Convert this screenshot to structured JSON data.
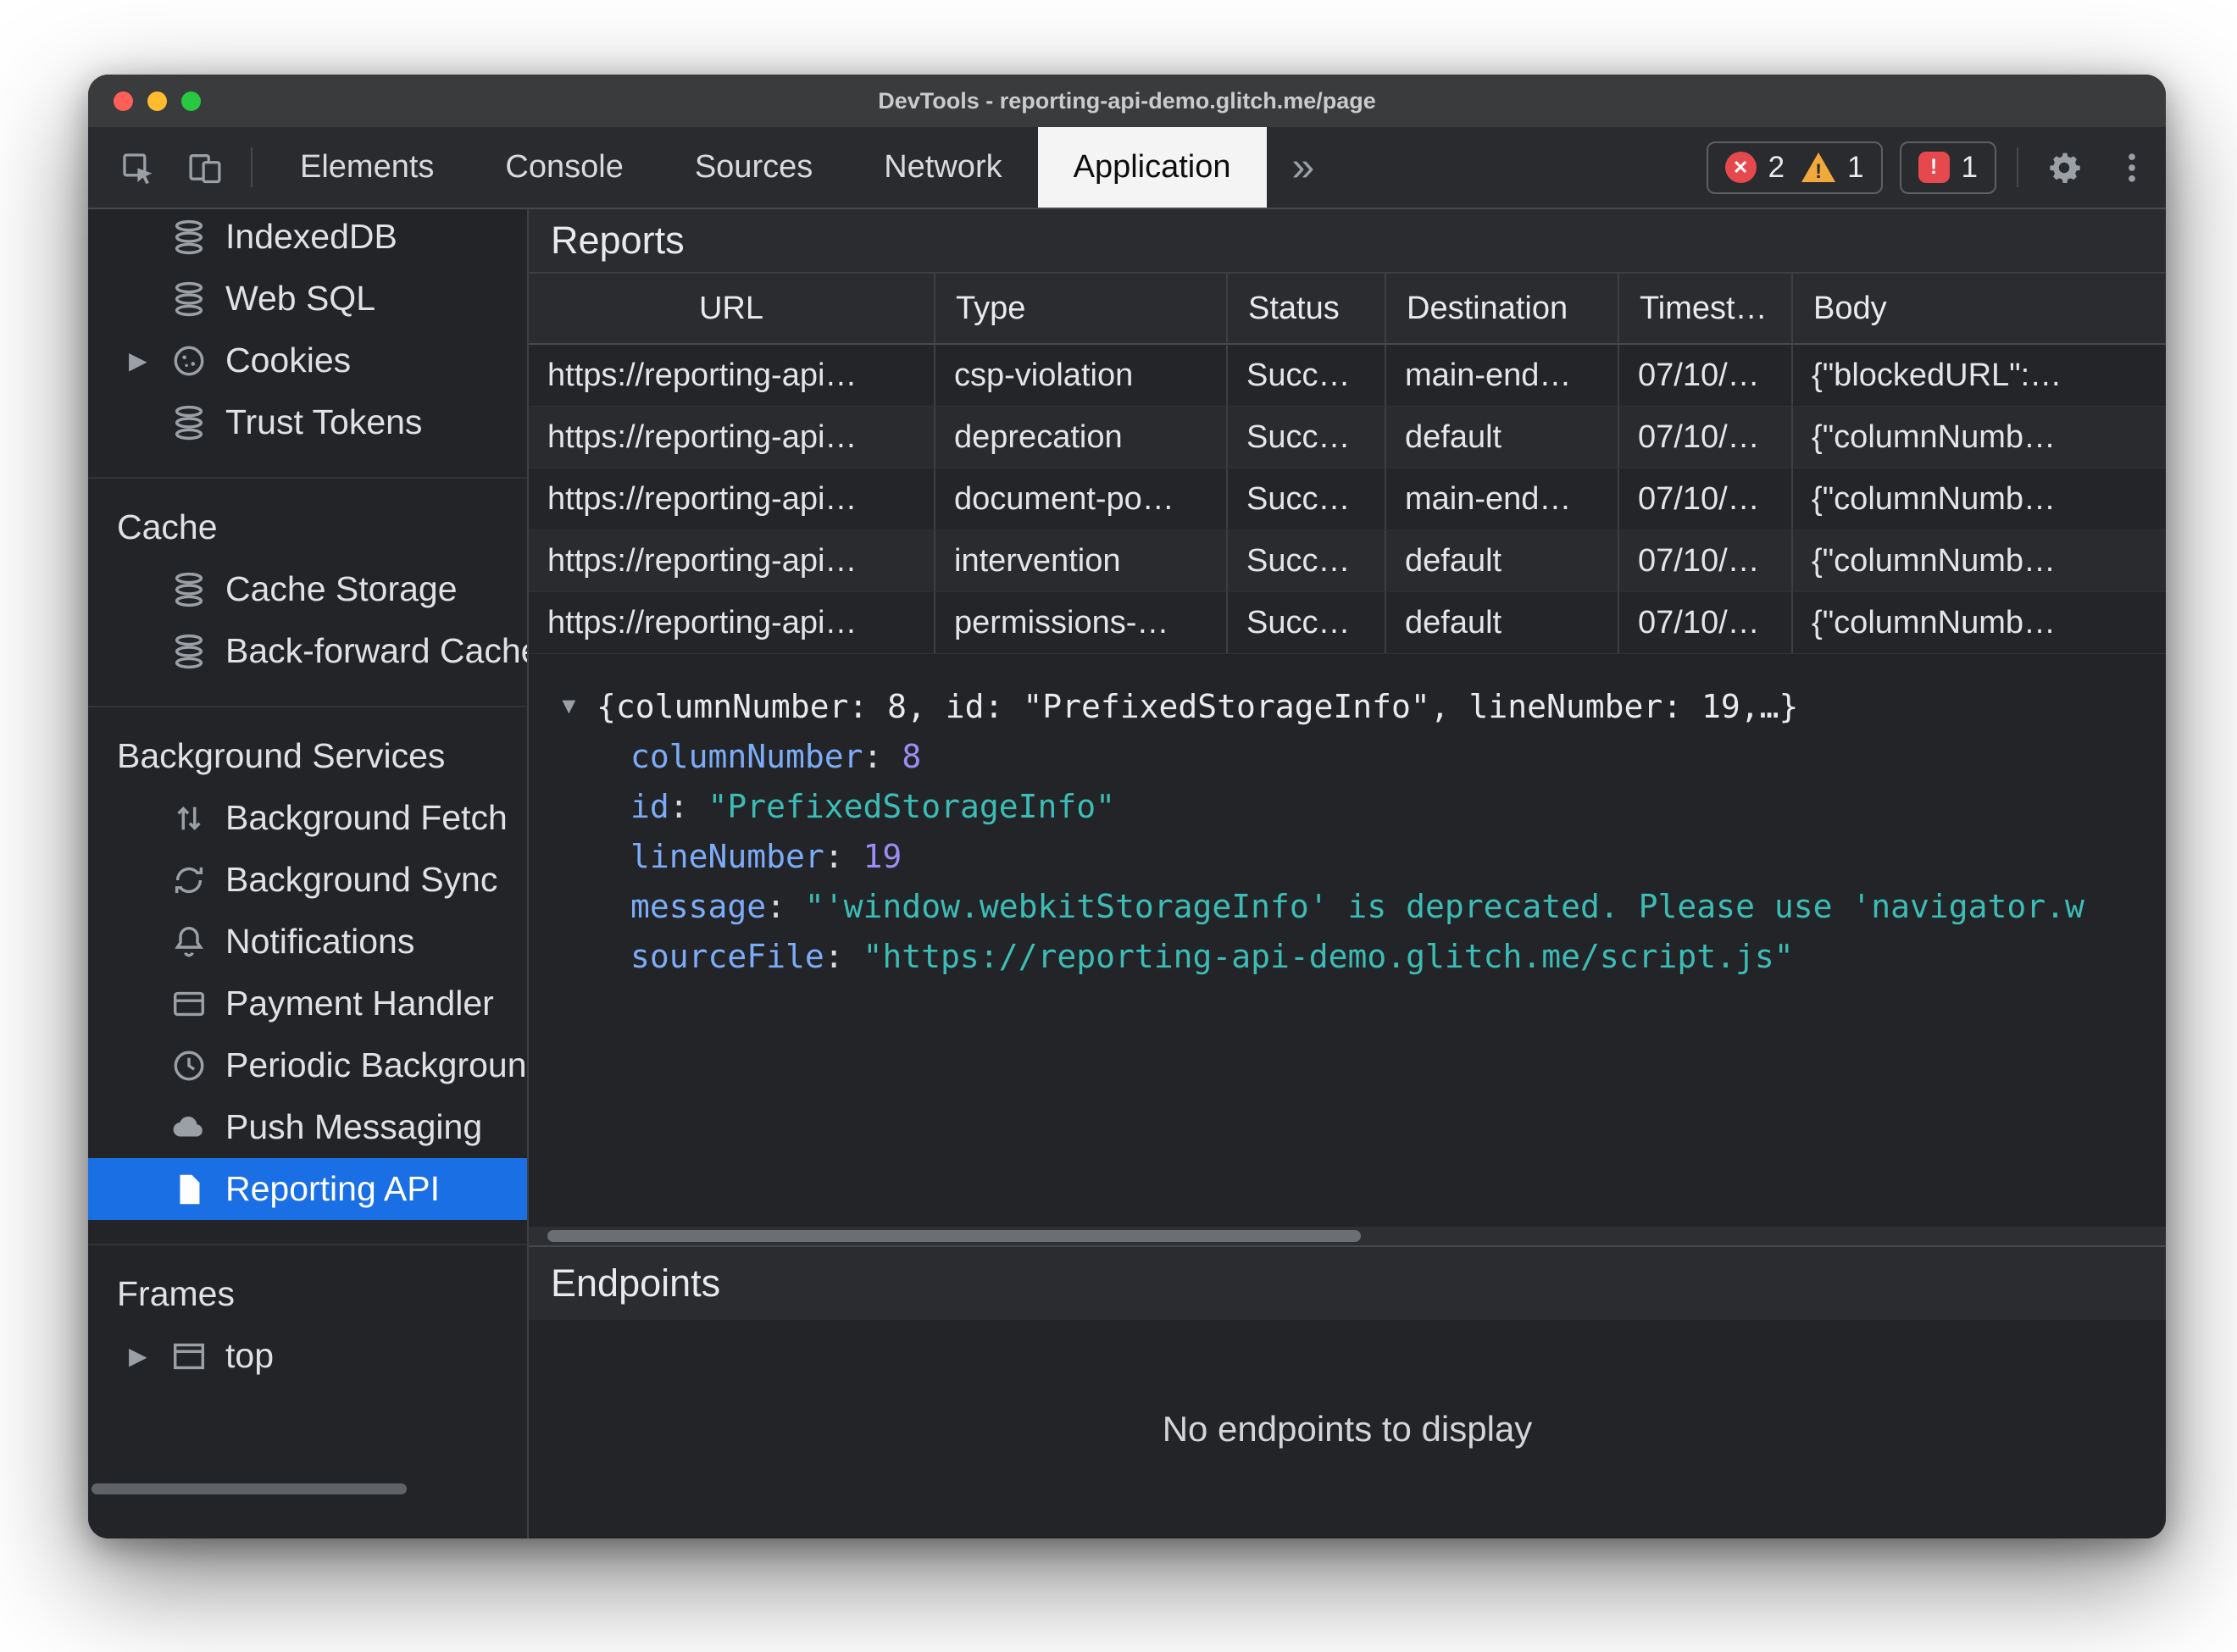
{
  "window": {
    "title": "DevTools - reporting-api-demo.glitch.me/page"
  },
  "colors": {
    "accent": "#1a73e8",
    "error": "#e5484d",
    "warning": "#f2a93c",
    "selected_tab": "#f4f4f5"
  },
  "toolbar": {
    "tabs": [
      {
        "label": "Elements"
      },
      {
        "label": "Console"
      },
      {
        "label": "Sources"
      },
      {
        "label": "Network"
      },
      {
        "label": "Application"
      }
    ],
    "more_tabs_icon": "chevron-double-right",
    "errors": "2",
    "warnings": "1",
    "issues": "1"
  },
  "sidebar": {
    "groups": [
      {
        "items": [
          {
            "label": "IndexedDB",
            "icon": "database-icon"
          },
          {
            "label": "Web SQL",
            "icon": "database-icon"
          },
          {
            "label": "Cookies",
            "icon": "cookie-icon"
          },
          {
            "label": "Trust Tokens",
            "icon": "database-icon"
          }
        ]
      },
      {
        "title": "Cache",
        "items": [
          {
            "label": "Cache Storage",
            "icon": "database-icon"
          },
          {
            "label": "Back-forward Cache",
            "icon": "database-icon"
          }
        ]
      },
      {
        "title": "Background Services",
        "items": [
          {
            "label": "Background Fetch",
            "icon": "fetch-arrows-icon"
          },
          {
            "label": "Background Sync",
            "icon": "sync-icon"
          },
          {
            "label": "Notifications",
            "icon": "bell-icon"
          },
          {
            "label": "Payment Handler",
            "icon": "payment-card-icon"
          },
          {
            "label": "Periodic Background Sync",
            "icon": "clock-icon"
          },
          {
            "label": "Push Messaging",
            "icon": "cloud-icon"
          },
          {
            "label": "Reporting API",
            "icon": "document-icon"
          }
        ]
      },
      {
        "title": "Frames",
        "items": [
          {
            "label": "top",
            "icon": "frame-icon"
          }
        ]
      }
    ]
  },
  "reports": {
    "title": "Reports",
    "columns": [
      "URL",
      "Type",
      "Status",
      "Destination",
      "Timest…",
      "Body"
    ],
    "rows": [
      {
        "url": "https://reporting-api…",
        "type": "csp-violation",
        "status": "Succ…",
        "destination": "main-end…",
        "timestamp": "07/10/…",
        "body": "{\"blockedURL\":…"
      },
      {
        "url": "https://reporting-api…",
        "type": "deprecation",
        "status": "Succ…",
        "destination": "default",
        "timestamp": "07/10/…",
        "body": "{\"columnNumb…"
      },
      {
        "url": "https://reporting-api…",
        "type": "document-po…",
        "status": "Succ…",
        "destination": "main-end…",
        "timestamp": "07/10/…",
        "body": "{\"columnNumb…"
      },
      {
        "url": "https://reporting-api…",
        "type": "intervention",
        "status": "Succ…",
        "destination": "default",
        "timestamp": "07/10/…",
        "body": "{\"columnNumb…"
      },
      {
        "url": "https://reporting-api…",
        "type": "permissions-…",
        "status": "Succ…",
        "destination": "default",
        "timestamp": "07/10/…",
        "body": "{\"columnNumb…"
      }
    ]
  },
  "detail": {
    "preview": "{columnNumber: 8, id: \"PrefixedStorageInfo\", lineNumber: 19,…}",
    "fields": [
      {
        "key": "columnNumber",
        "value": "8",
        "kind": "number"
      },
      {
        "key": "id",
        "value": "\"PrefixedStorageInfo\"",
        "kind": "string"
      },
      {
        "key": "lineNumber",
        "value": "19",
        "kind": "number"
      },
      {
        "key": "message",
        "value": "\"'window.webkitStorageInfo' is deprecated. Please use 'navigator.w",
        "kind": "string"
      },
      {
        "key": "sourceFile",
        "value": "\"https://reporting-api-demo.glitch.me/script.js\"",
        "kind": "string"
      }
    ]
  },
  "endpoints": {
    "title": "Endpoints",
    "empty_message": "No endpoints to display"
  }
}
